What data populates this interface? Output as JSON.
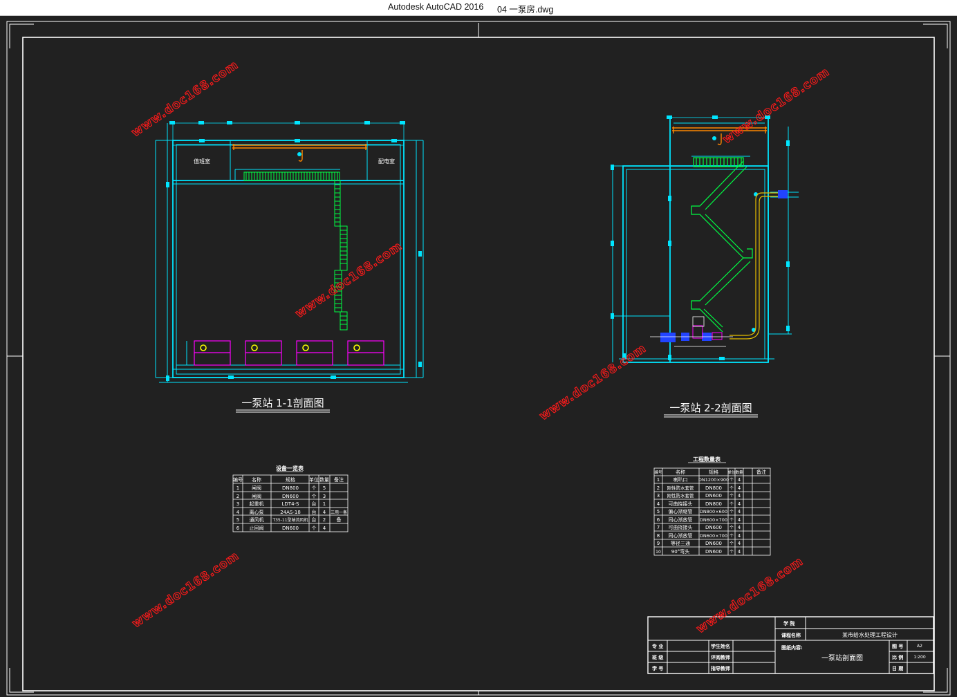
{
  "window": {
    "app_title": "Autodesk AutoCAD 2016",
    "file_title": "04 一泵房.dwg"
  },
  "views": {
    "section_1": {
      "title": "一泵站 1-1剖面图",
      "room_left": "值班室",
      "room_right": "配电室"
    },
    "section_2": {
      "title": "一泵站 2-2剖面图"
    }
  },
  "equipment_table": {
    "title": "设备一览表",
    "headers": [
      "编号",
      "名称",
      "规格",
      "单位",
      "数量",
      "备注"
    ],
    "rows": [
      [
        "1",
        "闸阀",
        "DN800",
        "个",
        "5",
        ""
      ],
      [
        "2",
        "闸阀",
        "DN600",
        "个",
        "3",
        ""
      ],
      [
        "3",
        "起重机",
        "LDT4-S",
        "台",
        "1",
        ""
      ],
      [
        "4",
        "离心泵",
        "24AS-18",
        "台",
        "4",
        "三用一备"
      ],
      [
        "5",
        "通风机",
        "T35-11型轴流风机",
        "台",
        "2",
        "备"
      ],
      [
        "6",
        "止回阀",
        "DN600",
        "个",
        "4",
        ""
      ]
    ]
  },
  "quantity_table": {
    "title": "工程数量表",
    "headers": [
      "编号",
      "名称",
      "规格",
      "单位",
      "数量",
      "备注"
    ],
    "rows": [
      [
        "1",
        "喇叭口",
        "DN1200×900",
        "个",
        "4",
        ""
      ],
      [
        "2",
        "刚性防水套管",
        "DN800",
        "个",
        "4",
        ""
      ],
      [
        "3",
        "刚性防水套管",
        "DN600",
        "个",
        "4",
        ""
      ],
      [
        "4",
        "可曲挠接头",
        "DN800",
        "个",
        "4",
        ""
      ],
      [
        "5",
        "偏心渐缩管",
        "DN800×600",
        "个",
        "4",
        ""
      ],
      [
        "6",
        "同心渐放管",
        "DN600×700",
        "个",
        "4",
        ""
      ],
      [
        "7",
        "可曲挠接头",
        "DN600",
        "个",
        "4",
        ""
      ],
      [
        "8",
        "同心渐放管",
        "DN600×700",
        "个",
        "4",
        ""
      ],
      [
        "9",
        "等径三通",
        "DN600",
        "个",
        "4",
        ""
      ],
      [
        "10",
        "90°弯头",
        "DN600",
        "个",
        "4",
        ""
      ]
    ]
  },
  "title_block": {
    "school_label": "学 院",
    "project_label": "课程名称",
    "project": "某市给水处理工程设计",
    "content_label": "图纸内容:",
    "drawing_name": "一泵站剖面图",
    "major_label": "专 业",
    "class_label": "班 级",
    "student_id_label": "学 号",
    "student_label": "学生姓名",
    "advisor_label": "评阅教师",
    "teacher_label": "指导教师",
    "drawing_no_label": "图 号",
    "drawing_no": "A2",
    "scale_label": "比 例",
    "scale": "1:200",
    "date_label": "日 期"
  },
  "watermark": "www.doc168.com",
  "colors": {
    "background": "#212121",
    "frame": "#ffffff",
    "structure": "#00ffff",
    "stairs": "#00ff00",
    "pumps": "#ff00ff",
    "crane": "#ff8800",
    "watermark": "#ff1a1a"
  }
}
